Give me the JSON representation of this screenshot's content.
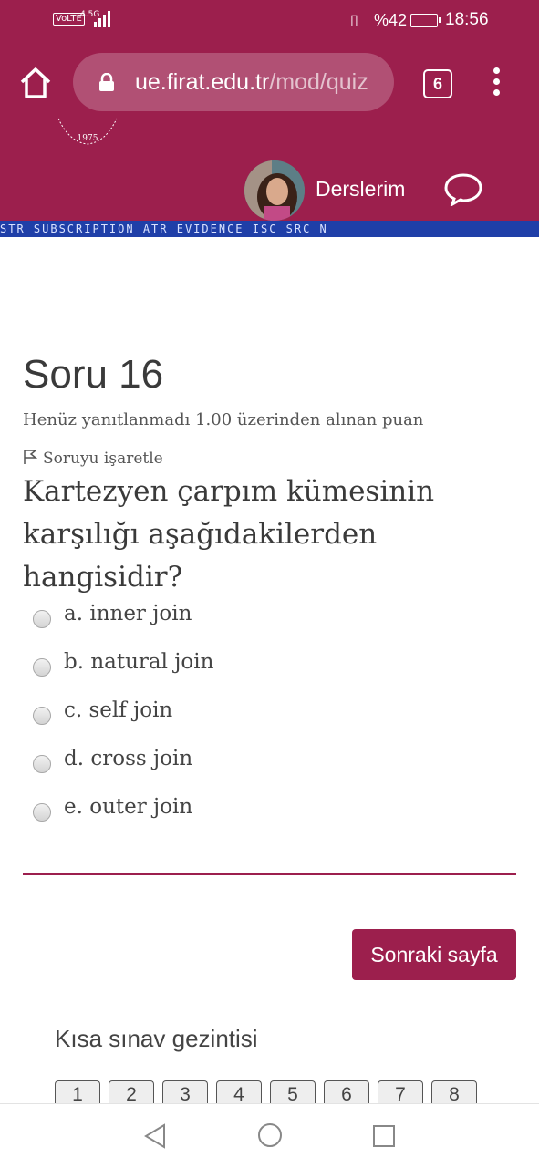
{
  "status_bar": {
    "volte": "VoLTE",
    "network": "4.5G",
    "battery_percent": "%42",
    "time": "18:56"
  },
  "browser": {
    "url_host": "ue.firat.edu.tr",
    "url_path": "/mod/quiz",
    "tab_count": "6"
  },
  "header": {
    "logo_year": "1975",
    "nav_label": "Derslerim",
    "banner_text": "STR SUBSCRIPTION   ATR   EVIDENCE   ISC   SRC N"
  },
  "question": {
    "title": "Soru 16",
    "state": "Henüz yanıtlanmadı  1.00 üzerinden alınan puan",
    "flag_label": "Soruyu işaretle",
    "text": "Kartezyen çarpım kümesinin karşılığı aşağıdakilerden hangisidir?",
    "options": [
      {
        "label": "a. inner join"
      },
      {
        "label": "b. natural join"
      },
      {
        "label": "c. self join"
      },
      {
        "label": "d. cross join"
      },
      {
        "label": "e. outer join"
      }
    ]
  },
  "next_button": "Sonraki sayfa",
  "quiz_navigation": {
    "title": "Kısa sınav gezintisi",
    "buttons": [
      "1",
      "2",
      "3",
      "4",
      "5",
      "6",
      "7",
      "8"
    ]
  },
  "colors": {
    "brand": "#9c1f4d",
    "banner": "#1f3fa8"
  }
}
